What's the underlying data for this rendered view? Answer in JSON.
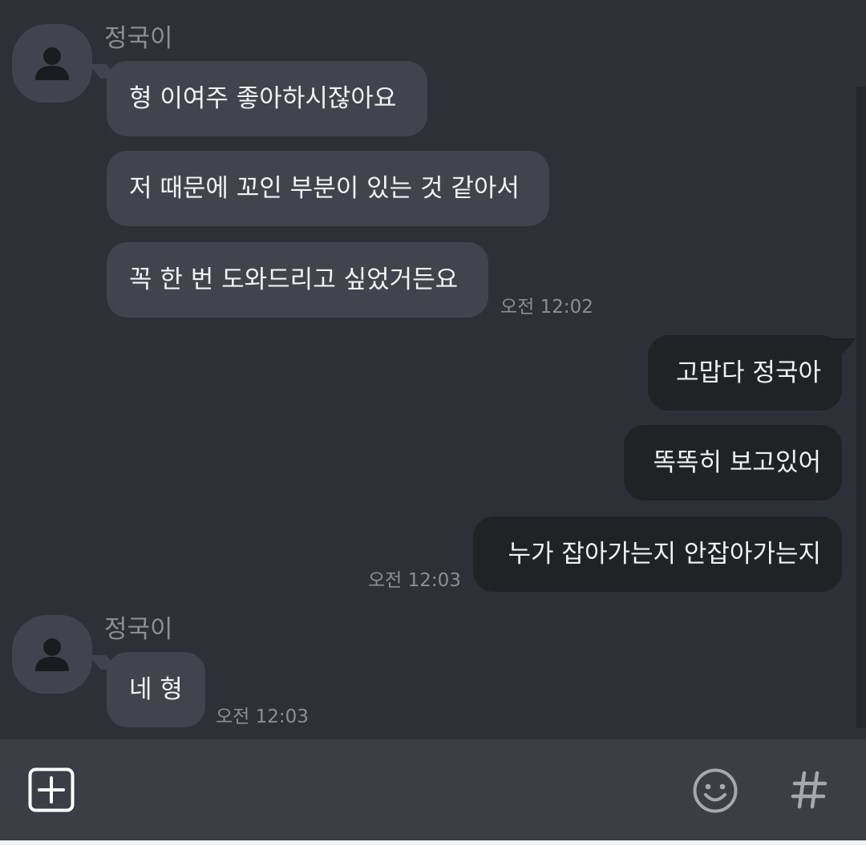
{
  "messages": [
    {
      "sender": "정국이",
      "text": "형 이여주 좋아하시잖아요"
    },
    {
      "text": "저 때문에 꼬인 부분이 있는 것 같아서"
    },
    {
      "text": "꼭 한 번 도와드리고 싶었거든요",
      "time": "오전 12:02"
    },
    {
      "text": "고맙다 정국아"
    },
    {
      "text": "똑똑히 보고있어"
    },
    {
      "text": "누가 잡아가는지 안잡아가는지",
      "time": "오전 12:03"
    },
    {
      "sender": "정국이",
      "text": "네 형",
      "time": "오전 12:03"
    }
  ],
  "icons": {
    "avatar": "person-icon",
    "attach": "plus-square-icon",
    "emoji": "smile-icon",
    "hashtag": "hash-icon"
  },
  "colors": {
    "background": "#2d3036",
    "incoming_bubble": "#41444d",
    "outgoing_bubble": "#212226",
    "input_bar": "#3b3e45"
  }
}
